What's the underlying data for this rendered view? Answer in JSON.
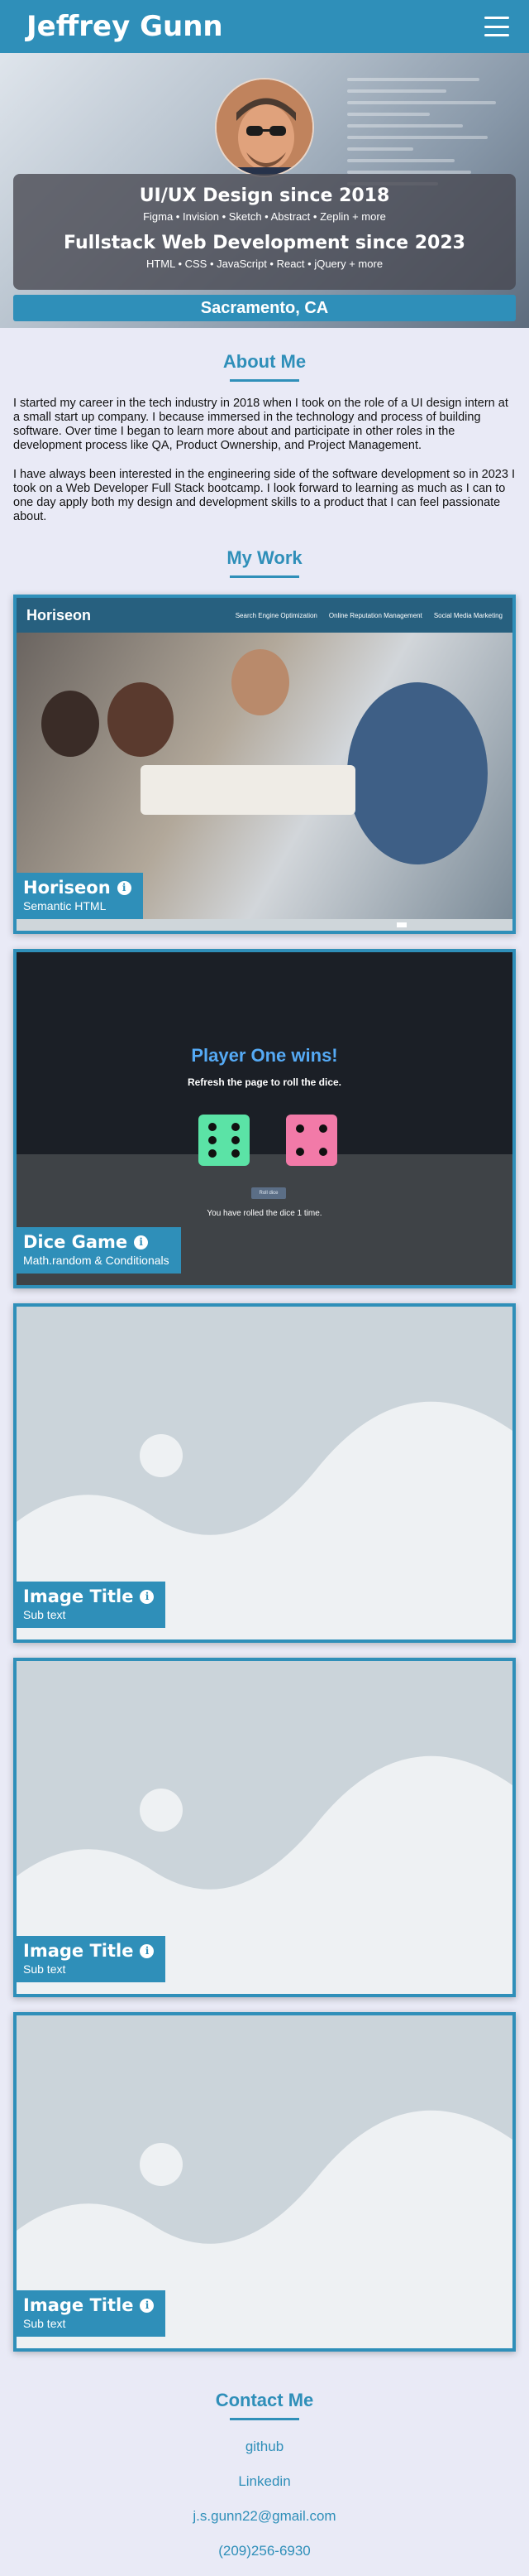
{
  "header": {
    "title": "Jeffrey Gunn",
    "menu_icon": "hamburger-menu-icon"
  },
  "hero": {
    "heading1": "UI/UX Design since 2018",
    "skills1": "Figma • Invision • Sketch • Abstract • Zeplin + more",
    "heading2": "Fullstack Web Development since 2023",
    "skills2": "HTML • CSS • JavaScript • React • jQuery + more",
    "location": "Sacramento, CA"
  },
  "about": {
    "title": "About Me",
    "p1": "I started my career in the tech industry in 2018 when I took on the role of a UI design intern at a small start up company. I because immersed in the technology and process of building software. Over time I began to learn more about and participate in other roles in the development process like QA, Product Ownership, and Project Management.",
    "p2": "I have always been interested in the engineering side of the software development so in 2023 I took on a Web Developer Full Stack bootcamp. I look forward to learning as much as I can to one day apply both my design and development skills to a product that I can feel passionate about."
  },
  "work": {
    "title": "My Work",
    "projects": [
      {
        "title": "Horiseon",
        "subtitle": "Semantic HTML",
        "preview": {
          "logo": "Horiseon",
          "links": [
            "Search Engine Optimization",
            "Online Reputation Management",
            "Social Media Marketing"
          ]
        }
      },
      {
        "title": "Dice Game",
        "subtitle": "Math.random & Conditionals",
        "preview": {
          "winner": "Player One wins!",
          "instruction": "Refresh the page to roll the dice.",
          "button": "Roll dice",
          "rolls": "You have rolled the dice 1 time.",
          "die1_color": "#5be3a6",
          "die2_color": "#f27aa8"
        }
      },
      {
        "title": "Image Title",
        "subtitle": "Sub text"
      },
      {
        "title": "Image Title",
        "subtitle": "Sub text"
      },
      {
        "title": "Image Title",
        "subtitle": "Sub text"
      }
    ]
  },
  "contact": {
    "title": "Contact Me",
    "links": [
      "github",
      "Linkedin",
      "j.s.gunn22@gmail.com",
      "(209)256-6930"
    ]
  },
  "colors": {
    "accent": "#2f8fb9",
    "background": "#e9eaf6"
  }
}
